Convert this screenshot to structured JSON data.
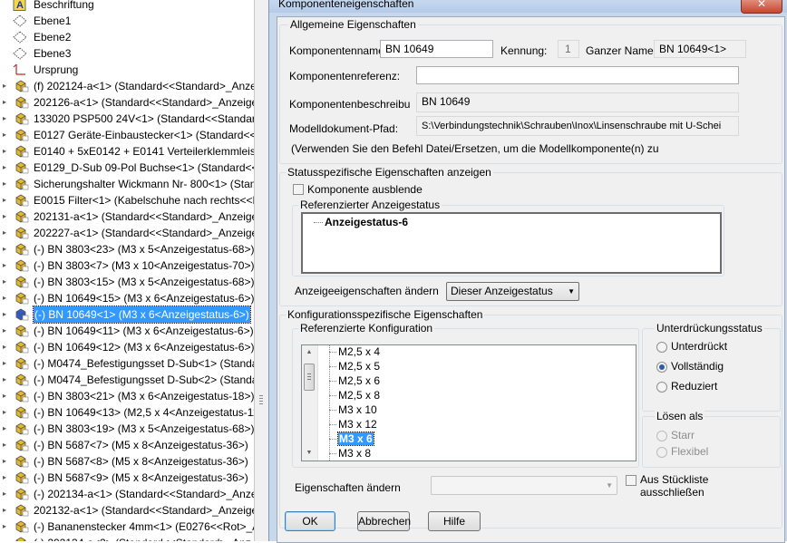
{
  "tree": {
    "top_items": [
      {
        "label": "Beschriftung",
        "icon": "annotation-icon"
      },
      {
        "label": "Ebene1",
        "icon": "plane-icon"
      },
      {
        "label": "Ebene2",
        "icon": "plane-icon"
      },
      {
        "label": "Ebene3",
        "icon": "plane-icon"
      },
      {
        "label": "Ursprung",
        "icon": "origin-icon"
      }
    ],
    "components": [
      "(f) 202124-a<1> (Standard<<Standard>_Anzei",
      "202126-a<1> (Standard<<Standard>_Anzeige",
      "133020 PSP500 24V<1> (Standard<<Standard>",
      "E0127 Geräte-Einbaustecker<1> (Standard<<S",
      "E0140 + 5xE0142 + E0141 Verteilerklemmleiste",
      "E0129_D-Sub 09-Pol Buchse<1> (Standard<<S",
      "Sicherungshalter Wickmann Nr- 800<1> (Stan",
      "E0015 Filter<1> (Kabelschuhe nach rechts<<K",
      "202131-a<1> (Standard<<Standard>_Anzeige",
      "202227-a<1> (Standard<<Standard>_Anzeige",
      "(-) BN 3803<23> (M3 x 5<Anzeigestatus-68>)",
      "(-) BN 3803<7> (M3 x 10<Anzeigestatus-70>)",
      "(-) BN 3803<15> (M3 x 5<Anzeigestatus-68>)",
      "(-) BN 10649<15> (M3 x 6<Anzeigestatus-6>)",
      "(-) BN 10649<1> (M3 x 6<Anzeigestatus-6>)",
      "(-) BN 10649<11> (M3 x 6<Anzeigestatus-6>)",
      "(-) BN 10649<12> (M3 x 6<Anzeigestatus-6>)",
      "(-) M0474_Befestigungsset D-Sub<1> (Standar",
      "(-) M0474_Befestigungsset D-Sub<2> (Standar",
      "(-) BN 3803<21> (M3 x 6<Anzeigestatus-18>)",
      "(-) BN 10649<13> (M2,5 x 4<Anzeigestatus-11",
      "(-) BN 3803<19> (M3 x 5<Anzeigestatus-68>)",
      "(-) BN 5687<7> (M5 x 8<Anzeigestatus-36>)",
      "(-) BN 5687<8> (M5 x 8<Anzeigestatus-36>)",
      "(-) BN 5687<9> (M5 x 8<Anzeigestatus-36>)",
      "(-) 202134-a<1> (Standard<<Standard>_Anze",
      "202132-a<1> (Standard<<Standard>_Anzeige",
      "(-) Bananenstecker 4mm<1> (E0276<<Rot>_A",
      "(-) 202134-a<2> (Standard<<Standard>_Anz"
    ],
    "selected_index": 14
  },
  "dialog": {
    "title": "Komponenteneigenschaften",
    "close_label": "✕",
    "general": {
      "title": "Allgemeine Eigenschaften",
      "name_label": "Komponentenname:",
      "name_value": "BN 10649",
      "id_label": "Kennung:",
      "id_value": "1",
      "fullname_label": "Ganzer Name:",
      "fullname_value": "BN 10649<1>",
      "ref_label": "Komponentenreferenz:",
      "ref_value": "",
      "desc_label": "Komponentenbeschreibung:",
      "desc_value": "BN 10649",
      "path_label": "Modelldokument-Pfad:",
      "path_value": "S:\\Verbindungstechnik\\Schrauben\\Inox\\Linsenschraube mit U-Schei",
      "hint": "(Verwenden Sie den Befehl Datei/Ersetzen, um die Modellkomponente(n) zu"
    },
    "display_state": {
      "title": "Statusspezifische Eigenschaften anzeigen",
      "hide_label": "Komponente ausblende",
      "referenced_title": "Referenzierter Anzeigestatus",
      "state_item": "Anzeigestatus-6",
      "change_label": "Anzeigeeigenschaften ändern",
      "change_value": "Dieser Anzeigestatus"
    },
    "config": {
      "title": "Konfigurationsspezifische Eigenschaften",
      "referenced_title": "Referenzierte Konfiguration",
      "items": [
        "M2,5 x 4",
        "M2,5 x 5",
        "M2,5 x 6",
        "M2,5 x 8",
        "M3 x 10",
        "M3 x 12",
        "M3 x 6",
        "M3 x 8"
      ],
      "selected_index": 6,
      "suppression_title": "Unterdrückungsstatus",
      "suppression_options": [
        "Unterdrückt",
        "Vollständig",
        "Reduziert"
      ],
      "suppression_selected": 1,
      "solve_title": "Lösen als",
      "solve_options": [
        "Starr",
        "Flexibel"
      ],
      "change_label": "Eigenschaften ändern",
      "change_value": "",
      "exclude_label_1": "Aus Stückliste",
      "exclude_label_2": "ausschließen"
    },
    "buttons": {
      "ok": "OK",
      "cancel": "Abbrechen",
      "help": "Hilfe"
    }
  }
}
